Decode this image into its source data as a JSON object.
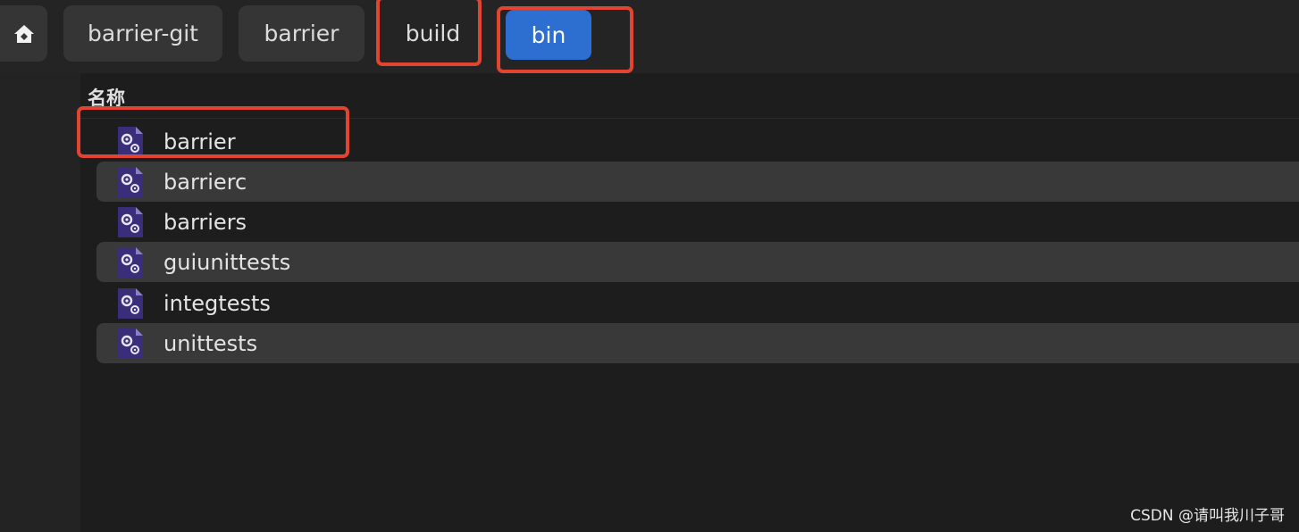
{
  "breadcrumb": {
    "home_icon": "home-icon",
    "items": [
      "barrier-git",
      "barrier",
      "build",
      "bin"
    ],
    "active_index": 3
  },
  "file_list": {
    "column_header": "名称",
    "item_icon": "executable-gear-file-icon",
    "items": [
      "barrier",
      "barrierc",
      "barriers",
      "guiunittests",
      "integtests",
      "unittests"
    ]
  },
  "watermark": "CSDN @请叫我川子哥",
  "colors": {
    "active_crumb": "#2d6ed1",
    "highlight": "#e2452f",
    "file_icon": "#3a2d7a"
  }
}
